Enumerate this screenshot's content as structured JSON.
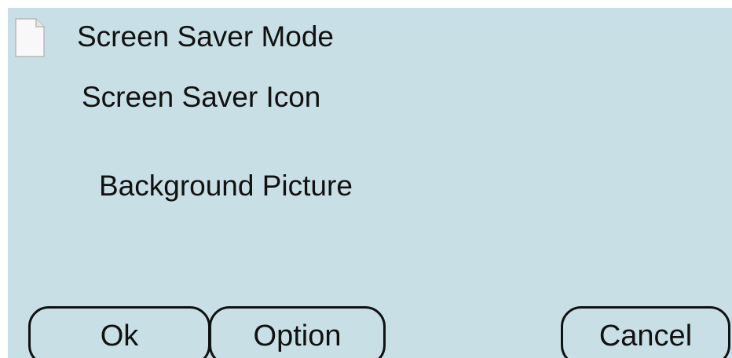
{
  "screen": {
    "background_color": "#c8dfe6",
    "items": {
      "mode_icon": "document-icon",
      "mode_label": "Screen Saver Mode",
      "icon_label": "Screen Saver Icon",
      "background_label": "Background Picture"
    },
    "buttons": {
      "ok_label": "Ok",
      "option_label": "Option",
      "cancel_label": "Cancel"
    }
  }
}
